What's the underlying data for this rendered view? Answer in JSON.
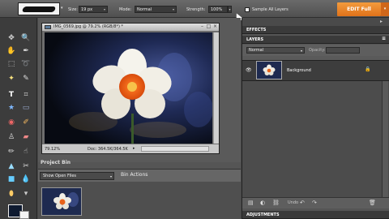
{
  "options_bar": {
    "size_label": "Size:",
    "size_value": "19 px",
    "mode_label": "Mode:",
    "mode_value": "Normal",
    "strength_label": "Strength:",
    "strength_value": "100%",
    "sample_all_layers": "Sample All Layers",
    "edit_full": "EDIT Full"
  },
  "toolbox": {
    "tools": [
      "move-tool",
      "zoom-tool",
      "hand-tool",
      "eyedropper-tool",
      "marquee-tool",
      "lasso-tool",
      "magic-wand-tool",
      "quick-selection-tool",
      "type-tool",
      "crop-tool",
      "cookie-cutter-tool",
      "straighten-tool",
      "red-eye-tool",
      "spot-healing-tool",
      "clone-stamp-tool",
      "eraser-tool",
      "brush-tool",
      "smudge-tool",
      "rectangle-tool",
      "blur-tool",
      "sponge-tool",
      "paint-bucket-tool"
    ]
  },
  "document": {
    "title": "IMG_0569.jpg @ 79.2% (RGB/8*) *",
    "zoom": "79.12%",
    "doc_size": "Doc: 364.5K/364.5K"
  },
  "project_bin": {
    "label": "Project Bin",
    "filter": "Show Open Files",
    "bin_actions": "Bin Actions"
  },
  "panels": {
    "effects": "EFFECTS",
    "layers": "LAYERS",
    "blend_mode": "Normal",
    "opacity_label": "Opacity:",
    "layer_name": "Background",
    "undo_label": "Undo",
    "adjustments": "ADJUSTMENTS"
  },
  "colors": {
    "accent": "#e88a2a",
    "foreground": "#0e1a30",
    "background": "#f4f4f4"
  }
}
